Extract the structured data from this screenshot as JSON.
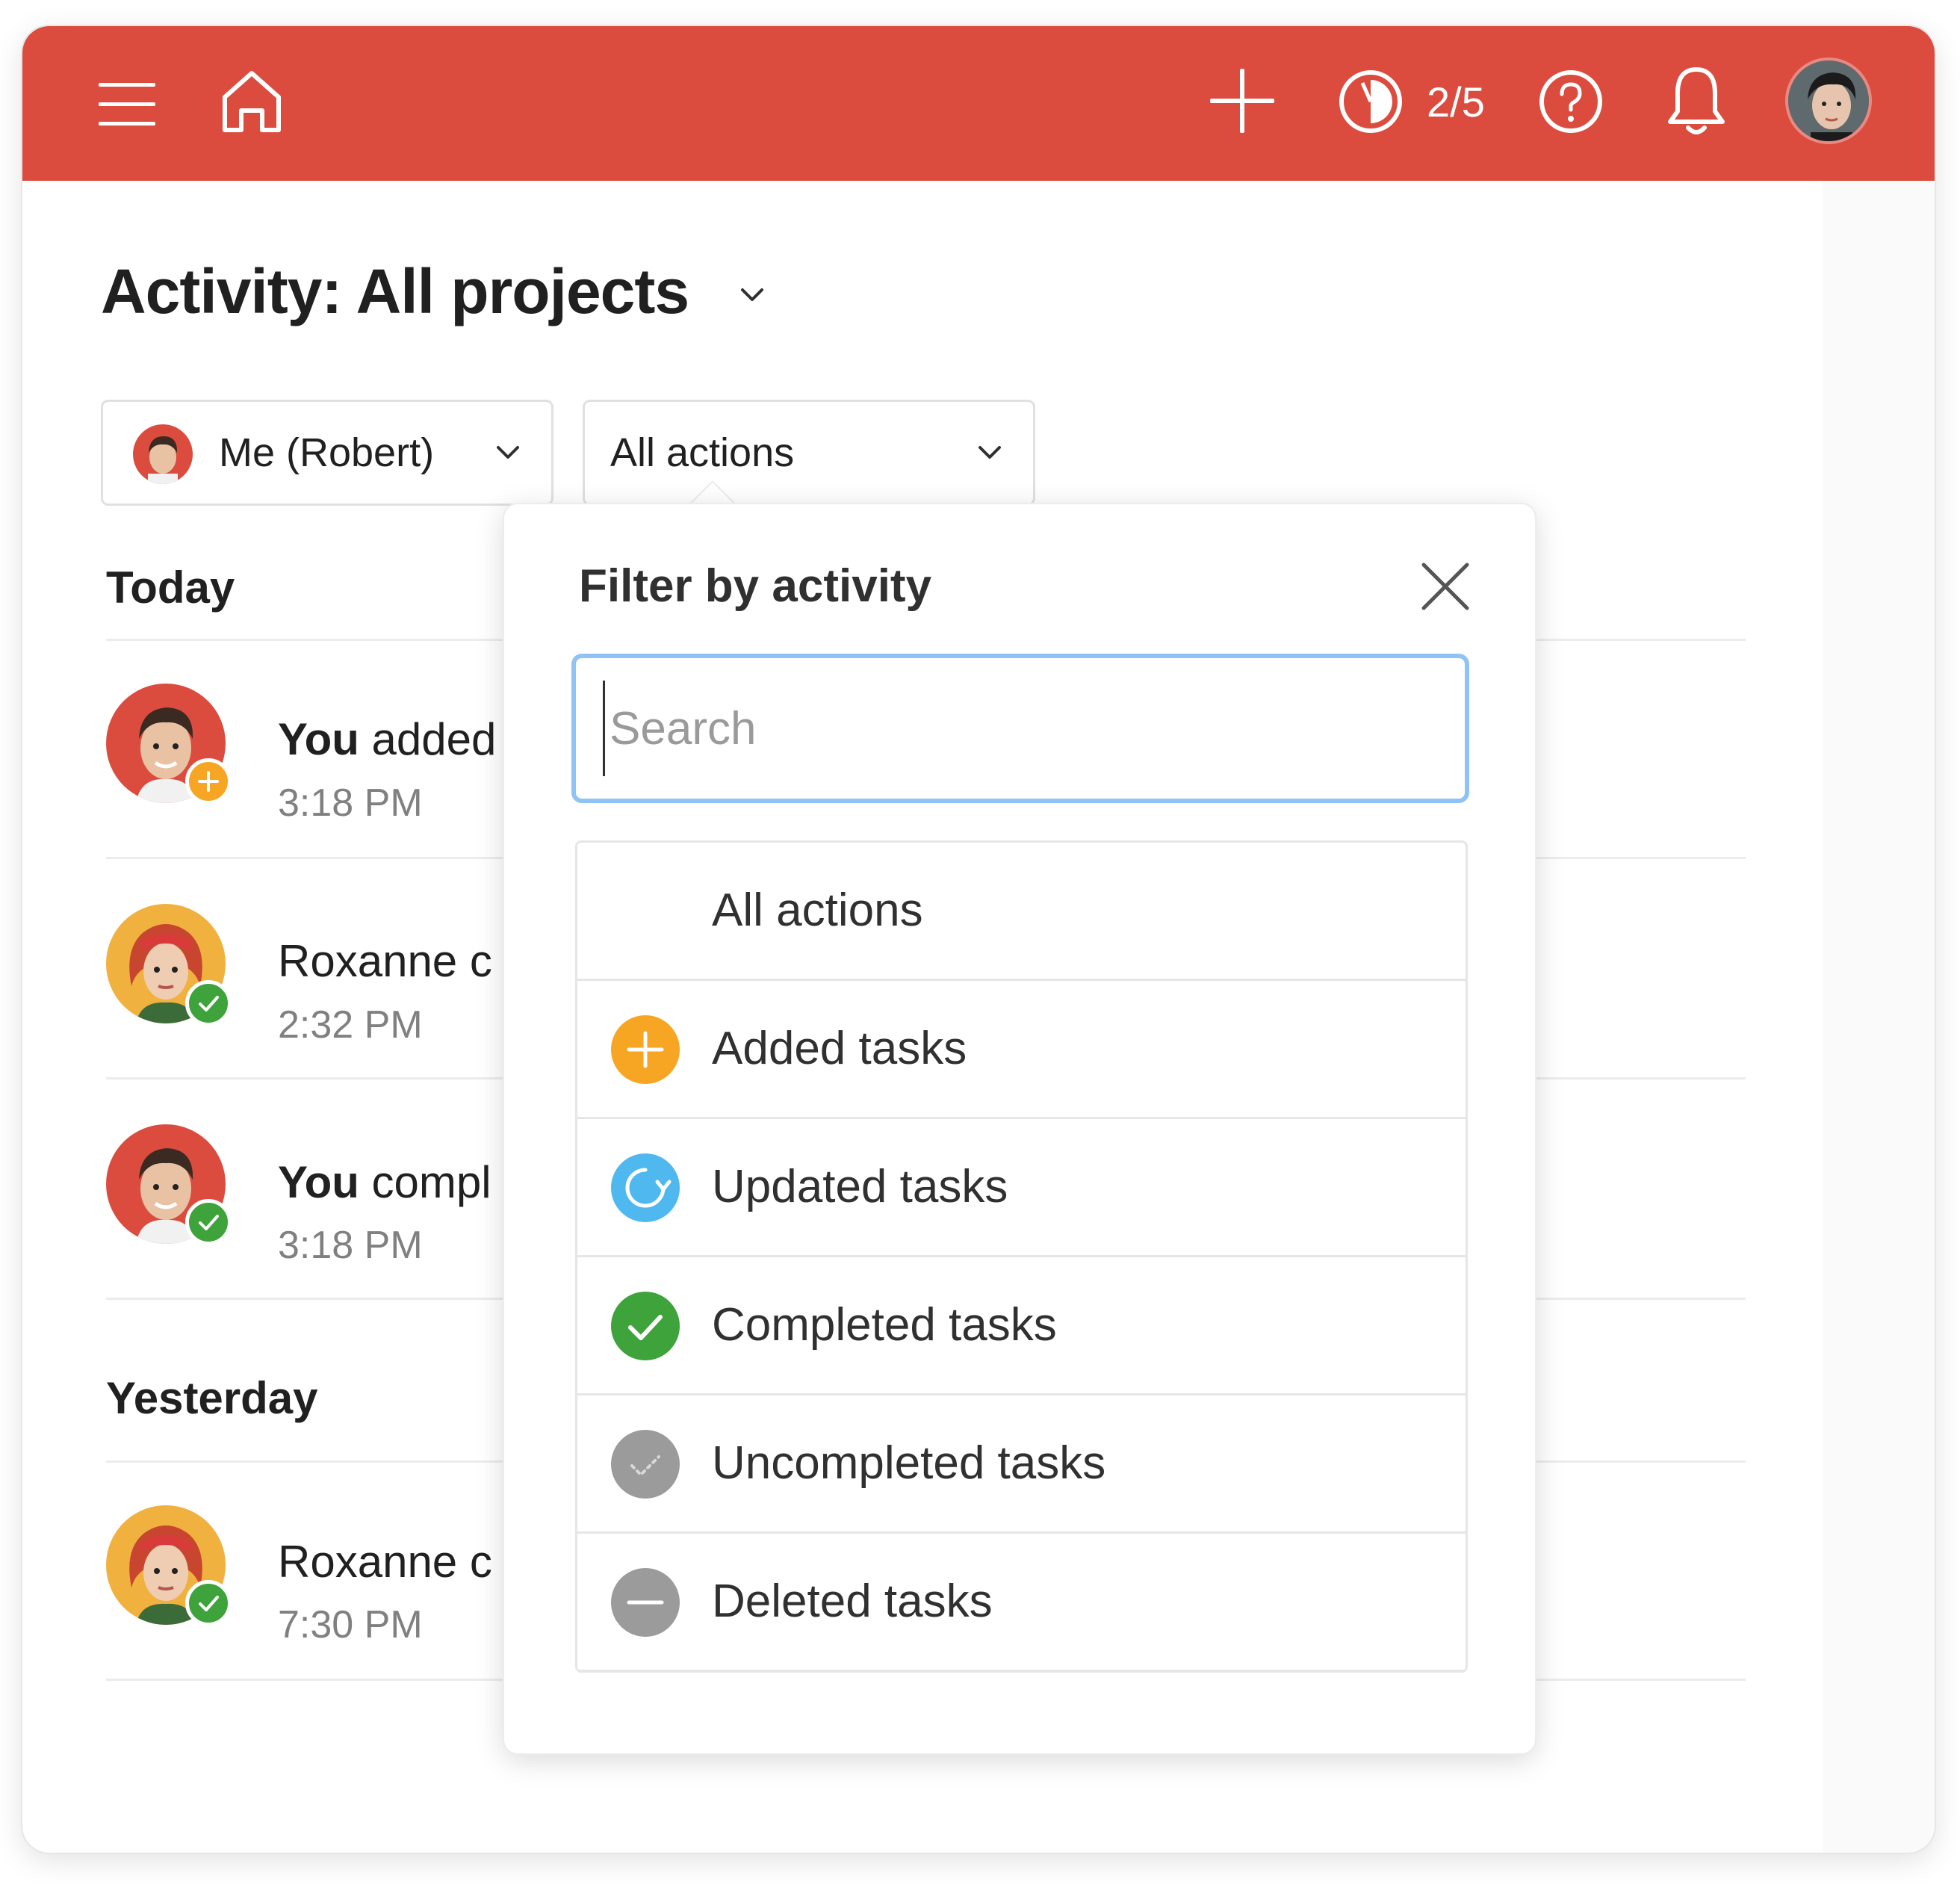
{
  "topbar": {
    "bg_color": "#db4c3f",
    "menu_icon": "hamburger-menu-icon",
    "home_icon": "home-icon",
    "add_icon": "plus-icon",
    "karma_icon": "productivity-pie-icon",
    "karma_progress": "2/5",
    "help_icon": "question-circle-icon",
    "notifications_icon": "bell-icon",
    "avatar": "user-avatar"
  },
  "page": {
    "title": "Activity: All projects",
    "title_dropdown_icon": "chevron-down-icon"
  },
  "filters": {
    "person": {
      "label": "Me (Robert)",
      "avatar": "robert-avatar"
    },
    "action": {
      "label": "All actions"
    }
  },
  "sections": [
    {
      "heading": "Today",
      "items": [
        {
          "actor": "You",
          "rest": " added",
          "time": "3:18 PM",
          "badge": "added",
          "person": "robert"
        },
        {
          "actor": "",
          "rest": "Roxanne c",
          "time": "2:32 PM",
          "badge": "completed",
          "person": "roxanne"
        },
        {
          "actor": "You",
          "rest": " compl",
          "time": "3:18 PM",
          "badge": "completed",
          "person": "robert"
        }
      ]
    },
    {
      "heading": "Yesterday",
      "items": [
        {
          "actor": "",
          "rest": "Roxanne c",
          "time": "7:30 PM",
          "badge": "completed",
          "person": "roxanne"
        }
      ]
    }
  ],
  "popover": {
    "title": "Filter by activity",
    "close_icon": "close-icon",
    "search_placeholder": "Search",
    "options": [
      {
        "label": "All actions",
        "icon": ""
      },
      {
        "label": "Added tasks",
        "icon": "plus-circle-icon",
        "color": "#f6a623"
      },
      {
        "label": "Updated tasks",
        "icon": "refresh-circle-icon",
        "color": "#4fb8ef"
      },
      {
        "label": "Completed tasks",
        "icon": "check-circle-icon",
        "color": "#3ea33a"
      },
      {
        "label": "Uncompleted tasks",
        "icon": "uncheck-circle-icon",
        "color": "#9b9b9b"
      },
      {
        "label": "Deleted tasks",
        "icon": "minus-circle-icon",
        "color": "#9b9b9b"
      }
    ]
  },
  "colors": {
    "added": "#f6a623",
    "completed": "#3ea33a",
    "updated": "#4fb8ef",
    "neutral": "#9b9b9b",
    "search_focus": "#8fc3f6"
  }
}
